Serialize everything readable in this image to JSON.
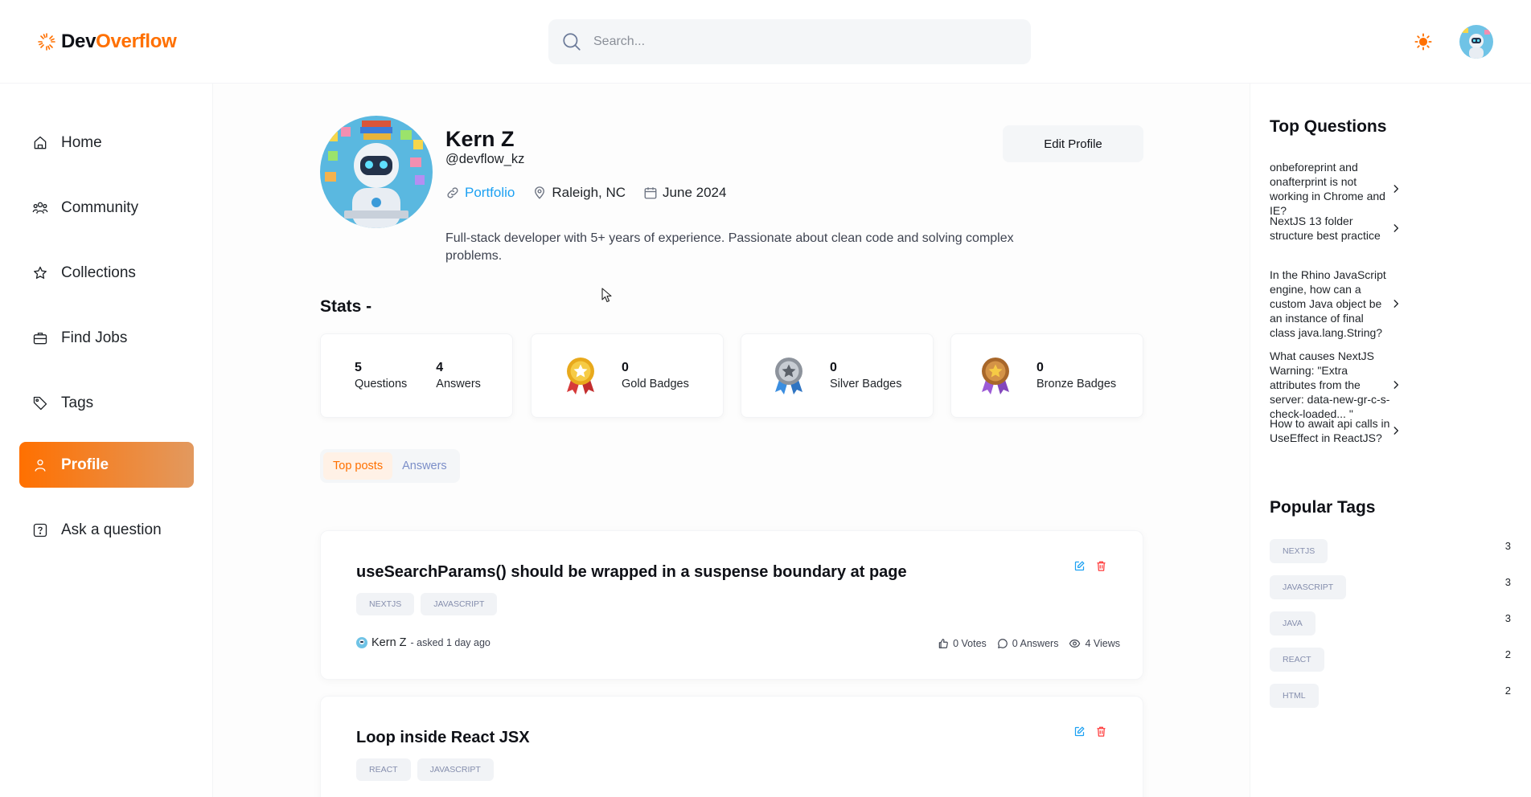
{
  "brand": {
    "name_part1": "Dev",
    "name_part2": "Overflow"
  },
  "search": {
    "placeholder": "Search..."
  },
  "nav": [
    {
      "label": "Home"
    },
    {
      "label": "Community"
    },
    {
      "label": "Collections"
    },
    {
      "label": "Find Jobs"
    },
    {
      "label": "Tags"
    },
    {
      "label": "Profile"
    },
    {
      "label": "Ask a question"
    }
  ],
  "profile": {
    "name": "Kern Z",
    "handle": "@devflow_kz",
    "portfolio_label": "Portfolio",
    "location": "Raleigh, NC",
    "joined": "June 2024",
    "bio": "Full-stack developer with 5+ years of experience. Passionate about clean code and solving complex problems.",
    "edit_label": "Edit Profile"
  },
  "stats": {
    "title": "Stats -",
    "questions": {
      "value": "5",
      "label": "Questions"
    },
    "answers": {
      "value": "4",
      "label": "Answers"
    },
    "gold": {
      "value": "0",
      "label": "Gold Badges"
    },
    "silver": {
      "value": "0",
      "label": "Silver Badges"
    },
    "bronze": {
      "value": "0",
      "label": "Bronze Badges"
    }
  },
  "tabs": [
    {
      "label": "Top posts"
    },
    {
      "label": "Answers"
    }
  ],
  "posts": [
    {
      "title": "useSearchParams() should be wrapped in a suspense boundary at page",
      "tags": [
        "NEXTJS",
        "JAVASCRIPT"
      ],
      "author": "Kern Z",
      "asked": "- asked 1 day ago",
      "votes": "0 Votes",
      "answers": "0 Answers",
      "views": "4 Views"
    },
    {
      "title": "Loop inside React JSX",
      "tags": [
        "REACT",
        "JAVASCRIPT"
      ]
    }
  ],
  "right": {
    "top_questions_title": "Top Questions",
    "top_questions": [
      "onbeforeprint and onafterprint is not working in Chrome and IE?",
      "NextJS 13 folder structure best practice",
      "In the Rhino JavaScript engine, how can a custom Java object be an instance of final class java.lang.String?",
      "What causes NextJS Warning: \"Extra attributes from the server: data-new-gr-c-s-check-loaded... \"",
      "How to await api calls in UseEffect in ReactJS?"
    ],
    "popular_tags_title": "Popular Tags",
    "popular_tags": [
      {
        "name": "NEXTJS",
        "count": "3"
      },
      {
        "name": "JAVASCRIPT",
        "count": "3"
      },
      {
        "name": "JAVA",
        "count": "3"
      },
      {
        "name": "REACT",
        "count": "2"
      },
      {
        "name": "HTML",
        "count": "2"
      }
    ]
  },
  "colors": {
    "accent": "#ff7000",
    "link": "#1da1f2",
    "delete": "#ff3b3b"
  }
}
